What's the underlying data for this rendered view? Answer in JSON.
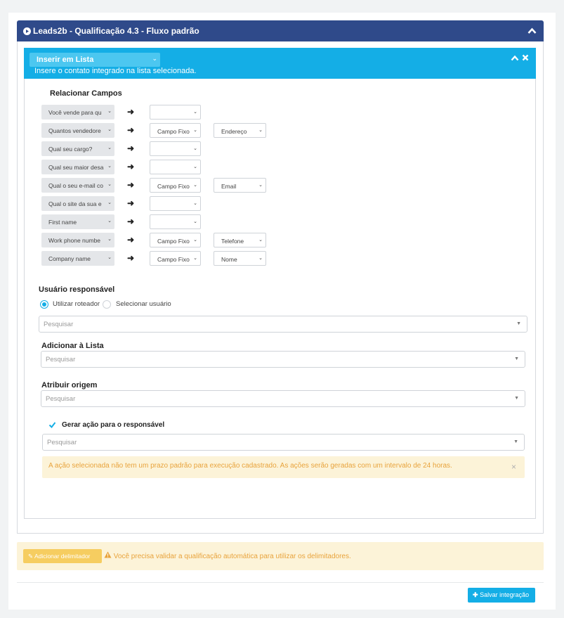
{
  "panel": {
    "title": "Leads2b - Qualificação 4.3 - Fluxo padrão"
  },
  "step": {
    "select_label": "Inserir em Lista",
    "description": "Insere o contato integrado na lista selecionada."
  },
  "relate": {
    "title": "Relacionar Campos",
    "rows": [
      {
        "source": "Você vende para qu",
        "type": "",
        "value": ""
      },
      {
        "source": "Quantos vendedore",
        "type": "Campo Fixo",
        "value": "Endereço"
      },
      {
        "source": "Qual seu cargo?",
        "type": "",
        "value": ""
      },
      {
        "source": "Qual seu maior desa",
        "type": "",
        "value": ""
      },
      {
        "source": "Qual o seu e-mail co",
        "type": "Campo Fixo",
        "value": "Email"
      },
      {
        "source": "Qual o site da sua e",
        "type": "",
        "value": ""
      },
      {
        "source": "First name",
        "type": "",
        "value": ""
      },
      {
        "source": "Work phone numbe",
        "type": "Campo Fixo",
        "value": "Telefone"
      },
      {
        "source": "Company name",
        "type": "Campo Fixo",
        "value": "Nome"
      }
    ]
  },
  "responsible": {
    "title": "Usuário responsável",
    "option_router": "Utilizar roteador",
    "option_user": "Selecionar usuário",
    "search_placeholder": "Pesquisar"
  },
  "list": {
    "title": "Adicionar à Lista",
    "search_placeholder": "Pesquisar"
  },
  "origin": {
    "title": "Atribuir origem",
    "search_placeholder": "Pesquisar"
  },
  "action": {
    "checkbox_label": "Gerar ação para o responsável",
    "search_placeholder": "Pesquisar"
  },
  "warning": {
    "text": "A ação selecionada não tem um prazo padrão para execução cadastrado. As ações serão geradas com um intervalo de 24 horas."
  },
  "footer": {
    "delimiter_button": "✎ Adicionar delimitador",
    "delimiter_warning": "Você precisa validar a qualificação automática para utilizar os delimitadores.",
    "save_button": "Salvar integração"
  },
  "colors": {
    "header_blue": "#2f4a8a",
    "accent": "#14aee6",
    "warning_bg": "#fcf3d8",
    "warning_text": "#e8a33c"
  }
}
